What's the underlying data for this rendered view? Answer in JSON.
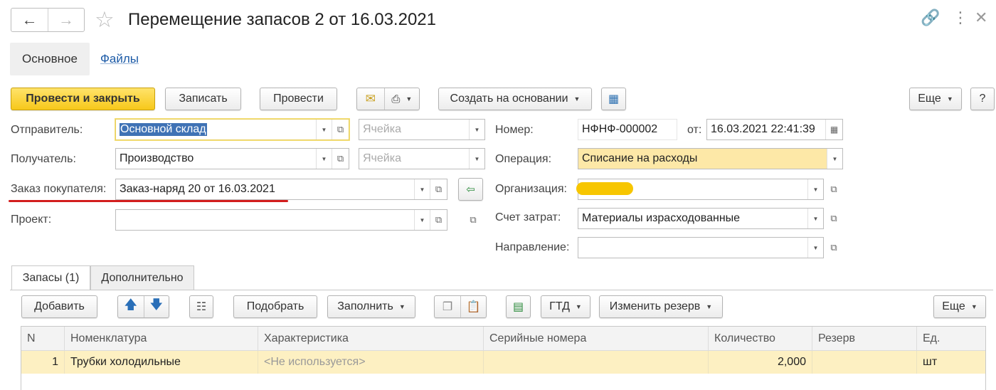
{
  "window": {
    "title": "Перемещение запасов 2 от 16.03.2021",
    "icons": {
      "back": "arrow-left-icon",
      "forward": "arrow-right-icon",
      "favorite": "star-icon",
      "link": "link-icon",
      "more": "more-vertical-icon",
      "close": "close-icon"
    }
  },
  "tabs": {
    "main": "Основное",
    "files": "Файлы"
  },
  "toolbar": {
    "post_close": "Провести и закрыть",
    "save": "Записать",
    "post": "Провести",
    "create_based": "Создать на основании",
    "more": "Еще",
    "help": "?"
  },
  "form": {
    "sender_label": "Отправитель:",
    "sender_value": "Основной склад",
    "recipient_label": "Получатель:",
    "recipient_value": "Производство",
    "cell_placeholder": "Ячейка",
    "order_label": "Заказ покупателя:",
    "order_value": "Заказ-наряд 20 от 16.03.2021",
    "project_label": "Проект:",
    "project_value": "",
    "number_label": "Номер:",
    "number_value": "НФНФ-000002",
    "date_label": "от:",
    "date_value": "16.03.2021 22:41:39",
    "operation_label": "Операция:",
    "operation_value": "Списание на расходы",
    "org_label": "Организация:",
    "org_value": "",
    "account_label": "Счет затрат:",
    "account_value": "Материалы израсходованные",
    "direction_label": "Направление:",
    "direction_value": ""
  },
  "lower_tabs": {
    "stocks": "Запасы (1)",
    "extra": "Дополнительно"
  },
  "table_toolbar": {
    "add": "Добавить",
    "pick": "Подобрать",
    "fill": "Заполнить",
    "gtd": "ГТД",
    "change_reserve": "Изменить резерв",
    "more": "Еще"
  },
  "table": {
    "columns": [
      "N",
      "Номенклатура",
      "Характеристика",
      "Серийные номера",
      "Количество",
      "Резерв",
      "Ед."
    ],
    "rows": [
      {
        "n": "1",
        "item": "Трубки холодильные",
        "characteristic": "<Не используется>",
        "serials": "",
        "qty": "2,000",
        "reserve": "",
        "unit": "шт"
      }
    ]
  },
  "colors": {
    "primary_button": "#f7c81a",
    "row_highlight": "#fdf0c2",
    "link": "#1a59a6",
    "underline_mark": "#d31e1e"
  }
}
